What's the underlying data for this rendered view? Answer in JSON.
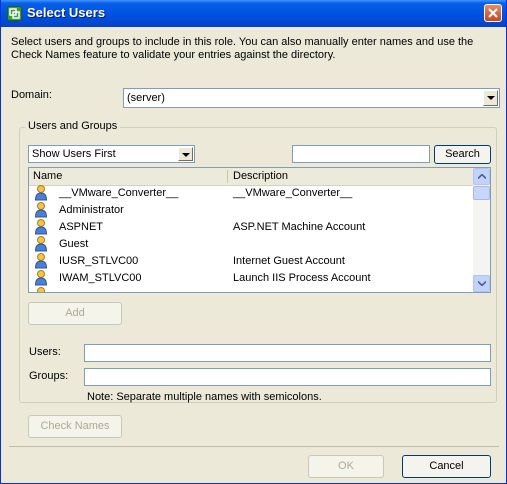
{
  "window": {
    "title": "Select Users",
    "close_icon": "close-icon",
    "app_icon": "vmware-icon"
  },
  "instructions": "Select users and groups to include in this role. You can also manually enter names and use the Check Names feature to validate your entries against the directory.",
  "domain": {
    "label": "Domain:",
    "value": "(server)"
  },
  "users_and_groups": {
    "legend": "Users and Groups",
    "filter": {
      "value": "Show Users First"
    },
    "search": {
      "value": "",
      "button": "Search"
    },
    "table": {
      "columns": [
        "Name",
        "Description"
      ],
      "rows": [
        {
          "name": "__VMware_Converter__",
          "description": "__VMware_Converter__"
        },
        {
          "name": "Administrator",
          "description": ""
        },
        {
          "name": "ASPNET",
          "description": "ASP.NET Machine Account"
        },
        {
          "name": "Guest",
          "description": ""
        },
        {
          "name": "IUSR_STLVC00",
          "description": "Internet Guest Account"
        },
        {
          "name": "IWAM_STLVC00",
          "description": "Launch IIS Process Account"
        }
      ]
    },
    "add_button": "Add",
    "users_label": "Users:",
    "users_value": "",
    "groups_label": "Groups:",
    "groups_value": "",
    "note": "Note: Separate multiple names with semicolons.",
    "check_names_button": "Check Names"
  },
  "footer": {
    "ok": "OK",
    "cancel": "Cancel"
  },
  "colors": {
    "title_blue": "#0054e3",
    "dialog_bg": "#ece9d8",
    "field_border": "#7f9db9"
  }
}
